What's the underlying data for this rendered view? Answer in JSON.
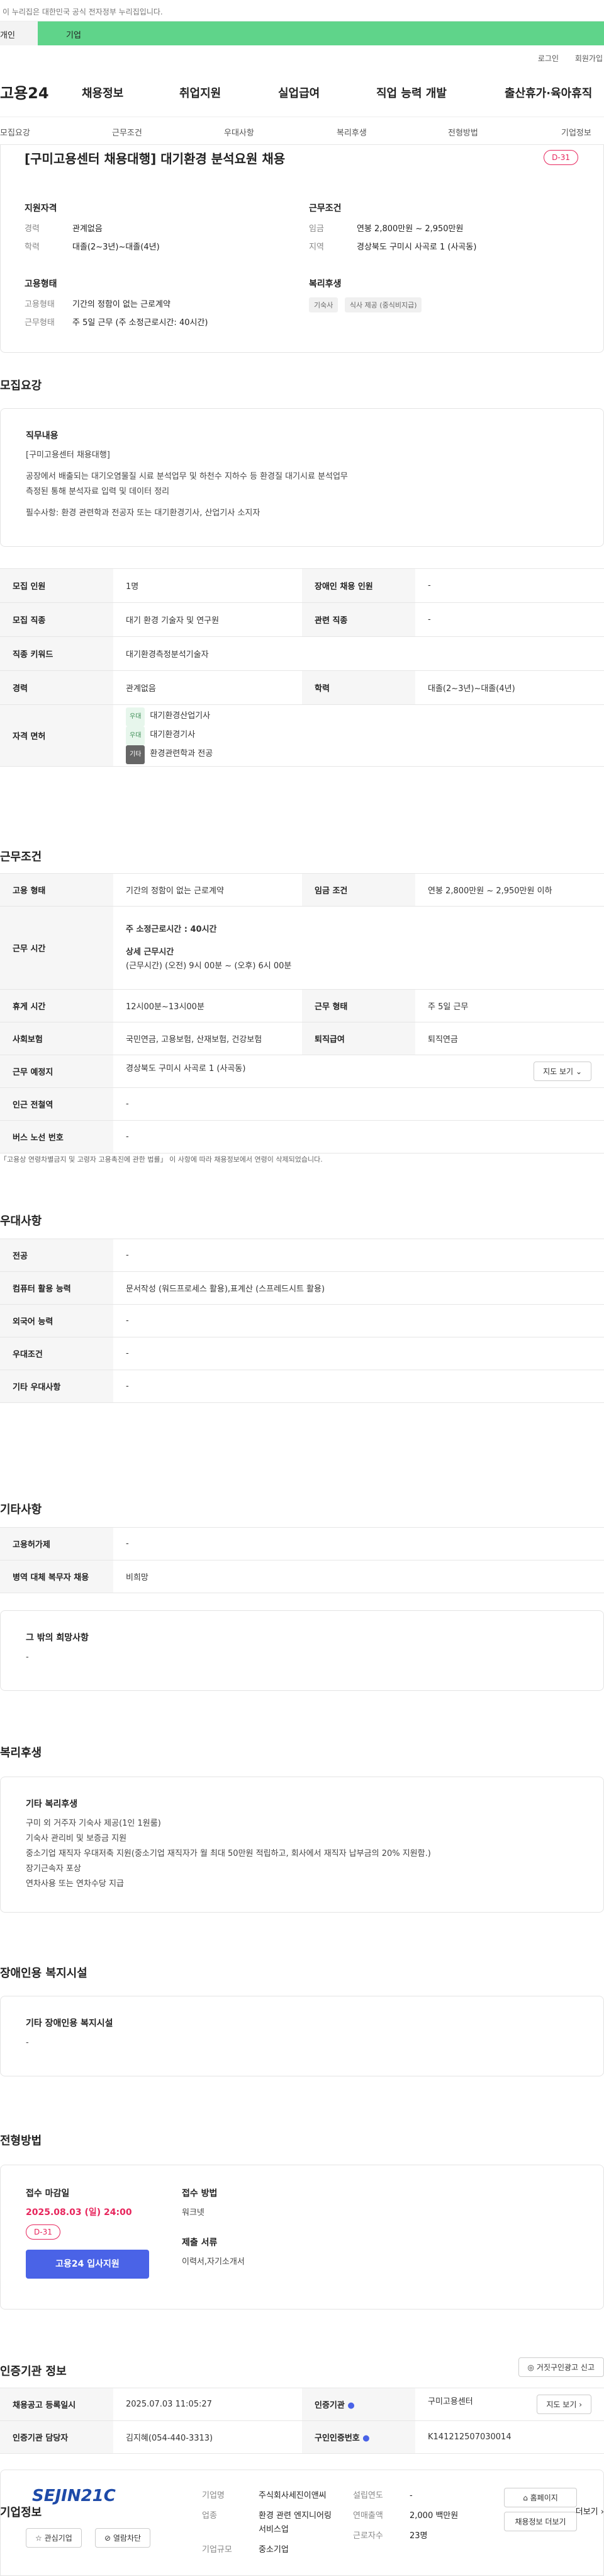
{
  "topbar": {
    "notice": "이 누리집은 대한민국 공식 전자정부 누리집입니다."
  },
  "user_tabs": [
    {
      "label": "개인"
    },
    {
      "label": "기업"
    }
  ],
  "util": {
    "login": "로그인",
    "join": "회원가입"
  },
  "gnb": {
    "logo": "고용24",
    "menus": [
      "채용정보",
      "취업지원",
      "실업급여",
      "직업 능력 개발",
      "출산휴가·육아휴직"
    ]
  },
  "subtabs": [
    "모집요강",
    "근무조건",
    "우대사항",
    "복리후생",
    "전형방법",
    "기업정보"
  ],
  "summary": {
    "title": "[구미고용센터 채용대행] 대기환경 분석요원 채용",
    "dday": "D-31",
    "qualification": {
      "heading": "지원자격",
      "career_k": "경력",
      "career_v": "관계없음",
      "edu_k": "학력",
      "edu_v": "대졸(2~3년)~대졸(4년)"
    },
    "conditions": {
      "heading": "근무조건",
      "wage_k": "임금",
      "wage_v": "연봉 2,800만원 ~ 2,950만원",
      "area_k": "지역",
      "area_v": "경상북도 구미시 사곡로 1 (사곡동)"
    },
    "employment": {
      "heading": "고용형태",
      "type_k": "고용형태",
      "type_v": "기간의 정함이 없는 근로계약",
      "hours_k": "근무형태",
      "hours_v": "주 5일 근무 (주 소정근로시간: 40시간)"
    },
    "welfare": {
      "heading": "복리후생",
      "chips": [
        "기숙사",
        "식사 제공 (중식비지급)"
      ]
    }
  },
  "recruit": {
    "section_title": "모집요강",
    "job_box": {
      "heading": "직무내용",
      "lines": [
        "[구미고용센터 채용대행]",
        "공장에서 배출되는 대기오염물질 시료 분석업무 및 하천수 지하수 등 환경질 대기시료 분석업무",
        "측정된 통해 분석자료 입력 및 데이터 정리",
        "필수사항: 환경 관련학과 전공자 또는 대기환경기사, 산업기사 소지자"
      ]
    },
    "rows": [
      {
        "k1": "모집 인원",
        "v1": "1명",
        "k2": "장애인 채용 인원",
        "v2": "-"
      },
      {
        "k1": "모집 직종",
        "v1": "대기 환경 기술자 및 연구원",
        "k2": "관련 직종",
        "v2": "-"
      },
      {
        "k1": "직종 키워드",
        "v1": "대기환경측정분석기술자"
      },
      {
        "k1": "경력",
        "v1": "관계없음",
        "k2": "학력",
        "v2": "대졸(2~3년)~대졸(4년)"
      }
    ],
    "license": {
      "k": "자격 면허",
      "items": [
        {
          "tag": "우대",
          "name": "대기환경산업기사"
        },
        {
          "tag": "우대",
          "name": "대기환경기사"
        },
        {
          "tag": "기타",
          "name": "환경관련학과 전공"
        }
      ]
    }
  },
  "work": {
    "section_title": "근무조건",
    "emp_type_k": "고용 형태",
    "emp_type_v": "기간의 정함이 없는 근로계약",
    "wage_k": "임금 조건",
    "wage_v": "연봉 2,800만원 ~ 2,950만원 이하",
    "hours_k": "근무 시간",
    "hours_main": "주 소정근로시간 : 40시간",
    "hours_detail_label": "상세 근무시간",
    "hours_detail": "(근무시간) (오전) 9시 00분 ~ (오후) 6시 00분",
    "break_k": "휴게 시간",
    "break_v": "12시00분~13시00분",
    "form_k": "근무 형태",
    "form_v": "주 5일 근무",
    "insurance_k": "사회보험",
    "insurance_v": "국민연금, 고용보험, 산재보험, 건강보험",
    "severance_k": "퇴직급여",
    "severance_v": "퇴직연금",
    "place_k": "근무 예정지",
    "place_v": "경상북도 구미시 사곡로 1 (사곡동)",
    "map_btn": "지도 보기",
    "subway_k": "인근 전철역",
    "subway_v": "-",
    "bus_k": "버스 노선 번호",
    "bus_v": "-",
    "note": "「고용상 연령차별금지 및 고령자 고용촉진에 관한 법률」 이 사항에 따라 채용정보에서 연령이 삭제되었습니다."
  },
  "prefer": {
    "section_title": "우대사항",
    "rows": [
      {
        "k": "전공",
        "v": "-"
      },
      {
        "k": "컴퓨터 활용 능력",
        "v": "문서작성 (워드프로세스 활용),표계산 (스프레드시트 활용)"
      },
      {
        "k": "외국어 능력",
        "v": "-"
      },
      {
        "k": "우대조건",
        "v": "-"
      },
      {
        "k": "기타 우대사항",
        "v": "-"
      }
    ]
  },
  "etc": {
    "section_title": "기타사항",
    "rows": [
      {
        "k": "고용허가제",
        "v": "-"
      },
      {
        "k": "병역 대체 복무자 채용",
        "v": "비희망"
      }
    ],
    "box_heading": "그 밖의 희망사항",
    "box_value": "-"
  },
  "benefit": {
    "section_title": "복리후생",
    "heading": "기타 복리후생",
    "lines": [
      "구미 외 거주자 기숙사 제공(1인 1원룸)",
      "기숙사 관리비 및 보증금 지원",
      "중소기업 재직자 우대저축 지원(중소기업 재직자가 월 최대 50만원 적립하고, 회사에서 재직자 납부금의 20% 지원함.)",
      "장기근속자 포상",
      "연차사용 또는 연차수당 지급"
    ]
  },
  "disability": {
    "section_title": "장애인용 복지시설",
    "heading": "기타 장애인용 복지시설",
    "value": "-"
  },
  "selection": {
    "section_title": "전형방법",
    "deadline_label": "접수 마감일",
    "deadline": "2025.08.03 (일) 24:00",
    "dday": "D-31",
    "apply_btn": "고용24 입사지원",
    "method_label": "접수 방법",
    "method": "워크넷",
    "docs_label": "제출 서류",
    "docs": "이력서,자기소개서"
  },
  "auth": {
    "section_title": "인증기관 정보",
    "report_btn": "거짓구인광고 신고",
    "reg_k": "채용공고 등록일시",
    "reg_v": "2025.07.03 11:05:27",
    "org_k": "인증기관",
    "org_v": "구미고용센터",
    "map_btn": "지도 보기",
    "manager_k": "인증기관 담당자",
    "manager_v": "김지혜(054-440-3313)",
    "no_k": "구인인증번호",
    "no_v": "K141212507030014"
  },
  "company": {
    "section_title": "기업정보",
    "more": "더보기",
    "logo_text": "SEJIN21C",
    "fav_btn": "관심기업",
    "block_btn": "열람차단",
    "name_k": "기업명",
    "name_v": "주식회사세진이앤씨",
    "industry_k": "업종",
    "industry_v": "환경 관련 엔지니어링 서비스업",
    "size_k": "기업규모",
    "size_v": "중소기업",
    "founded_k": "설립연도",
    "founded_v": "-",
    "sales_k": "연매출액",
    "sales_v": "2,000 백만원",
    "staff_k": "근로자수",
    "staff_v": "23명",
    "home_btn": "홈페이지",
    "list_btn": "채용정보 더보기"
  },
  "colors": {
    "brand_green": "#5fd48a",
    "dday_red": "#e7265d",
    "apply_blue": "#4a63e7"
  }
}
